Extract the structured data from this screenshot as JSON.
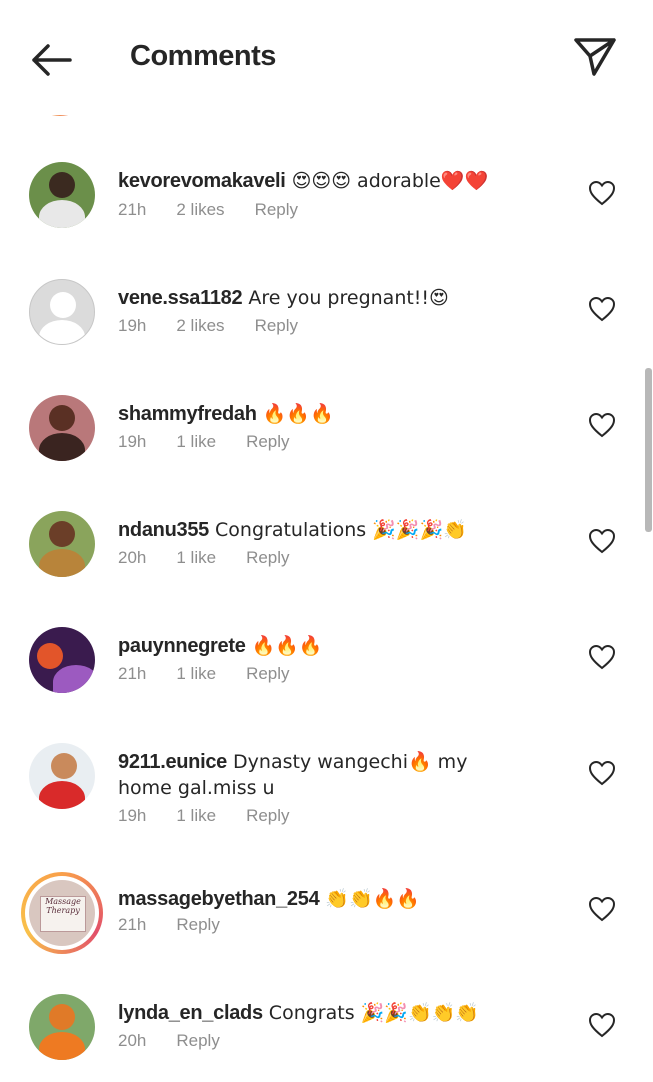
{
  "header": {
    "title": "Comments"
  },
  "comments": [
    {
      "username": "kevorevomakaveli",
      "text": " 😍😍😍 adorable❤️❤️",
      "time": "21h",
      "likes": "2 likes",
      "reply": "Reply"
    },
    {
      "username": "vene.ssa1182",
      "text": " Are you pregnant!!😍",
      "time": "19h",
      "likes": "2 likes",
      "reply": "Reply"
    },
    {
      "username": "shammyfredah",
      "text": " 🔥🔥🔥",
      "time": "19h",
      "likes": "1 like",
      "reply": "Reply"
    },
    {
      "username": "ndanu355",
      "text": " Congratulations 🎉🎉🎉👏",
      "time": "20h",
      "likes": "1 like",
      "reply": "Reply"
    },
    {
      "username": "pauynnegrete",
      "text": " 🔥🔥🔥",
      "time": "21h",
      "likes": "1 like",
      "reply": "Reply"
    },
    {
      "username": "9211.eunice",
      "text": " Dynasty wangechi🔥 my home gal.miss u",
      "time": "19h",
      "likes": "1 like",
      "reply": "Reply"
    },
    {
      "username": "massagebyethan_254",
      "text": " 👏👏🔥🔥",
      "time": "21h",
      "reply": "Reply",
      "avatar_text": "Massage Therapy"
    },
    {
      "username": "lynda_en_clads",
      "text": " Congrats 🎉🎉👏👏👏",
      "time": "20h",
      "reply": "Reply"
    }
  ],
  "colors": {
    "text": "#262626",
    "meta": "#8e8e8e",
    "story_ring": "#f9a04a"
  }
}
